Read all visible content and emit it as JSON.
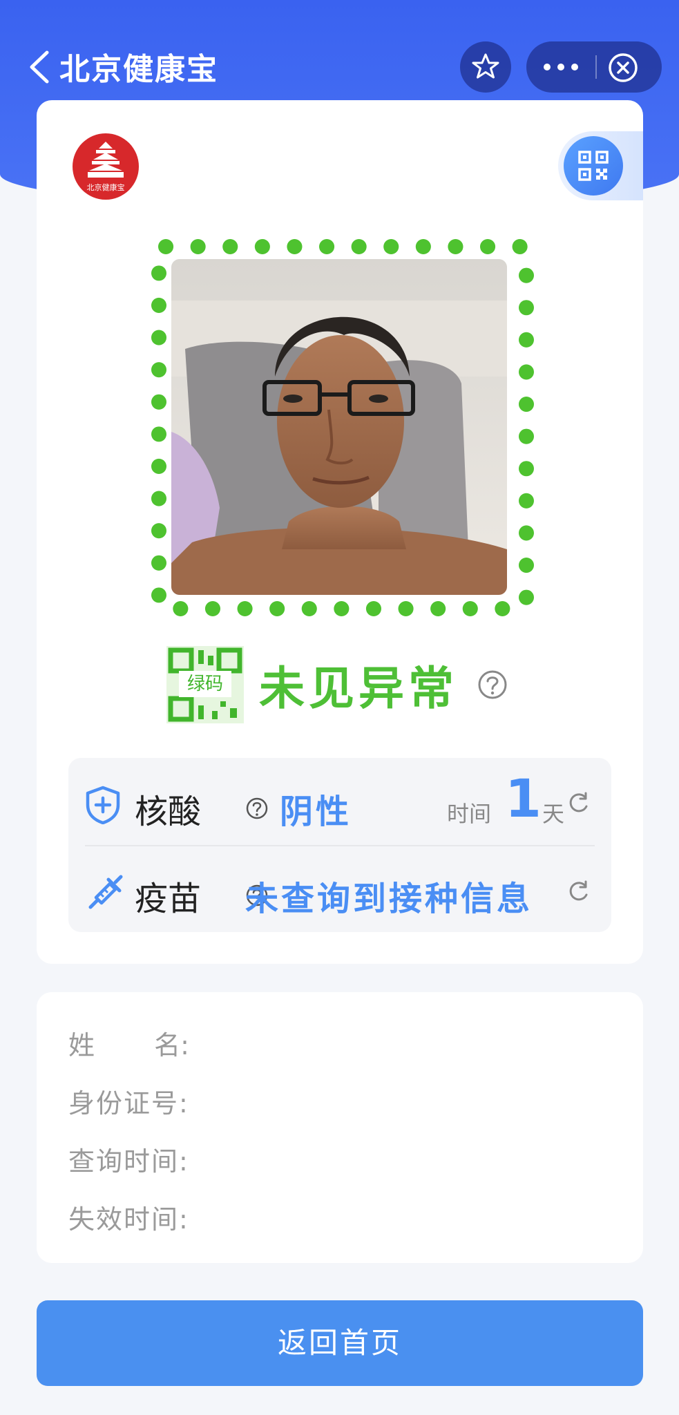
{
  "header": {
    "title": "北京健康宝",
    "back_icon": "chevron-left-icon",
    "favorite_icon": "star-icon",
    "more_icon": "ellipsis-icon",
    "close_icon": "close-circle-icon"
  },
  "card": {
    "logo_text": "北京健康宝",
    "qr_icon": "qr-code-icon",
    "photo_alt": "",
    "status": {
      "code_label": "绿码",
      "text": "未见异常",
      "color": "#4ebf36"
    },
    "nucleic": {
      "label": "核酸",
      "result": "阴性",
      "time_label": "时间",
      "time_value": "1",
      "time_unit": "天"
    },
    "vaccine": {
      "label": "疫苗",
      "result": "未查询到接种信息"
    }
  },
  "info": {
    "name_label": "姓 名:",
    "id_label": "身份证号:",
    "query_time_label": "查询时间:",
    "expire_time_label": "失效时间:"
  },
  "footer": {
    "home_button": "返回首页"
  },
  "colors": {
    "header_blue": "#3a62f0",
    "accent_blue": "#4a8ef4",
    "green": "#4ebf36",
    "button_blue": "#4a90f0"
  }
}
